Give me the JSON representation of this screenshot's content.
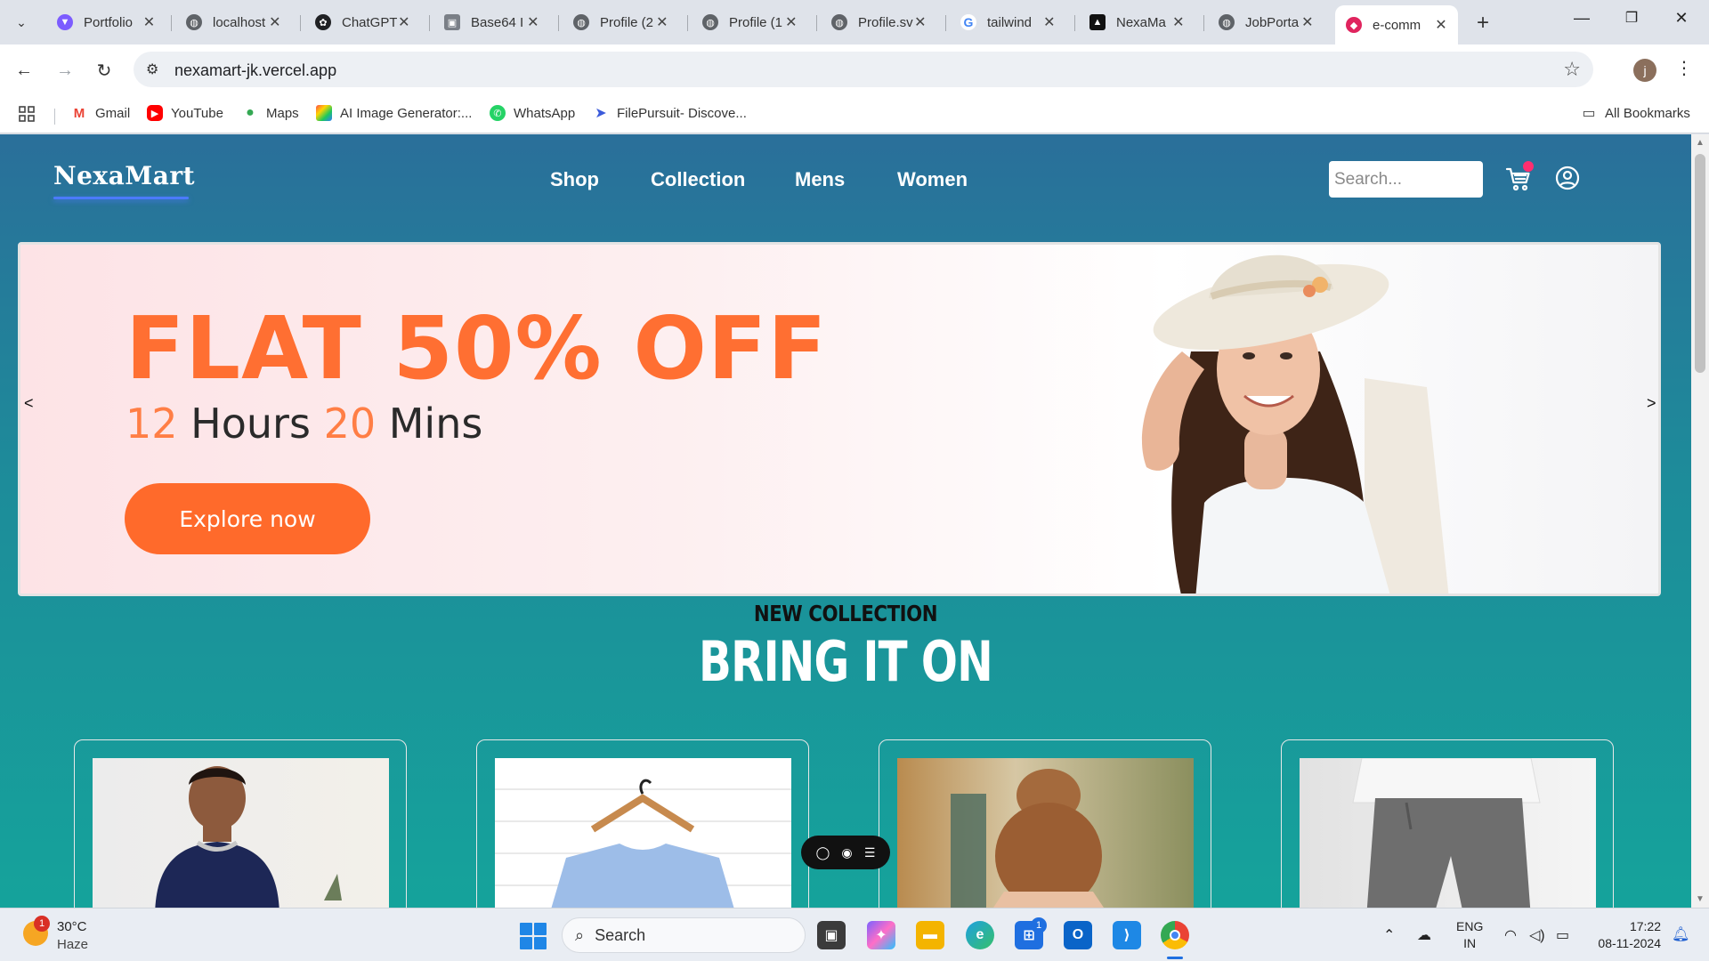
{
  "browser": {
    "tabs": [
      {
        "label": "Portfolio",
        "favicon_color": "#7c5cff"
      },
      {
        "label": "localhost",
        "favicon_color": "#5f6368"
      },
      {
        "label": "ChatGPT",
        "favicon_color": "#202124"
      },
      {
        "label": "Base64 I",
        "favicon_color": "#7a7f87"
      },
      {
        "label": "Profile (2",
        "favicon_color": "#5f6368"
      },
      {
        "label": "Profile (1",
        "favicon_color": "#5f6368"
      },
      {
        "label": "Profile.sv",
        "favicon_color": "#5f6368"
      },
      {
        "label": "tailwind",
        "favicon_color": "#4285f4"
      },
      {
        "label": "NexaMa",
        "favicon_color": "#111111"
      },
      {
        "label": "JobPorta",
        "favicon_color": "#5f6368"
      },
      {
        "label": "e-comm",
        "favicon_color": "#e0245e",
        "active": true
      }
    ],
    "url": "nexamart-jk.vercel.app",
    "profile_initial": "j",
    "bookmarks": [
      {
        "label": "Gmail",
        "icon": "gmail-icon",
        "color": "#ea4335"
      },
      {
        "label": "YouTube",
        "icon": "youtube-icon",
        "color": "#ff0000"
      },
      {
        "label": "Maps",
        "icon": "maps-icon",
        "color": "#34a853"
      },
      {
        "label": "AI Image Generator:...",
        "icon": "ai-image-icon",
        "color": "#8e44ad"
      },
      {
        "label": "WhatsApp",
        "icon": "whatsapp-icon",
        "color": "#25d366"
      },
      {
        "label": "FilePursuit- Discove...",
        "icon": "filepursuit-icon",
        "color": "#3b5bdb"
      }
    ],
    "all_bookmarks_label": "All Bookmarks"
  },
  "site": {
    "logo": "NexaMart",
    "nav": [
      "Shop",
      "Collection",
      "Mens",
      "Women"
    ],
    "search_placeholder": "Search...",
    "hero": {
      "headline": "FLAT 50% OFF",
      "timer": {
        "hours": "12",
        "hours_label": "Hours",
        "mins": "20",
        "mins_label": "Mins"
      },
      "cta_label": "Explore now",
      "prev_label": "<",
      "next_label": ">"
    },
    "collection": {
      "kicker": "NEW COLLECTION",
      "title": "BRING IT ON"
    },
    "accent_color": "#ff6a2b"
  },
  "taskbar": {
    "weather": {
      "temp": "30°C",
      "desc": "Haze",
      "badge": "1"
    },
    "search_label": "Search",
    "store_badge": "1",
    "lang_top": "ENG",
    "lang_bottom": "IN",
    "time": "17:22",
    "date": "08-11-2024"
  }
}
